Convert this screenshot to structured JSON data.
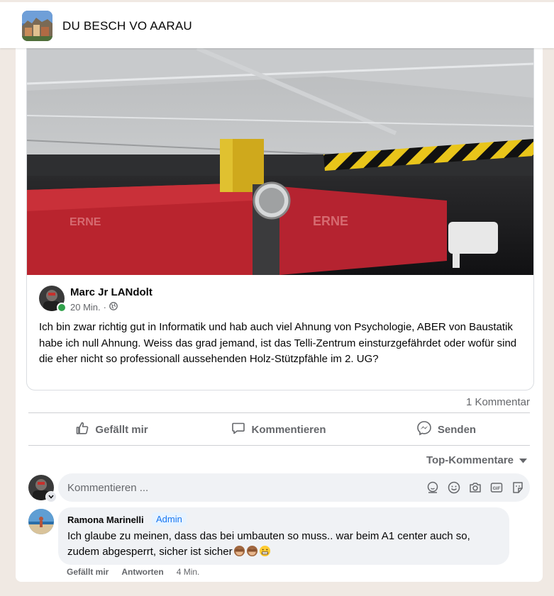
{
  "group": {
    "title": "DU BESCH VO AARAU",
    "avatar_icon": "group-photo-aarau"
  },
  "photo": {
    "banner_text": "ERNE",
    "post_label": "ERNE"
  },
  "shared_post": {
    "author": "Marc Jr LANdolt",
    "time": "20 Min.",
    "separator": "·",
    "audience_icon": "globe-icon",
    "text": "Ich bin zwar richtig gut in Informatik und hab auch viel Ahnung von Psychologie, ABER von Baustatik habe ich null Ahnung. Weiss das grad jemand, ist das Telli-Zentrum einsturzgefährdet oder wofür sind die eher nicht so professionall aussehenden Holz-Stützpfähle im 2. UG?"
  },
  "stats": {
    "comments": "1 Kommentar"
  },
  "actions": {
    "like": "Gefällt mir",
    "comment": "Kommentieren",
    "send": "Senden"
  },
  "comments_sort": {
    "label": "Top-Kommentare"
  },
  "comment_input": {
    "placeholder": "Kommentieren ..."
  },
  "comments": [
    {
      "author": "Ramona Marinelli",
      "badge": "Admin",
      "text": "Ich glaube zu meinen, dass das bei umbauten so muss.. war beim A1 center auch so, zudem abgesperrt, sicher ist sicher",
      "emojis": [
        "see-no-evil-monkey",
        "see-no-evil-monkey",
        "grimacing-face"
      ],
      "like_label": "Gefällt mir",
      "reply_label": "Antworten",
      "time": "4 Min."
    }
  ],
  "colors": {
    "accent_blue": "#1877f2",
    "text_primary": "#050505",
    "text_secondary": "#65676b",
    "online_green": "#31a24c",
    "page_background": "#f0e9e3"
  }
}
